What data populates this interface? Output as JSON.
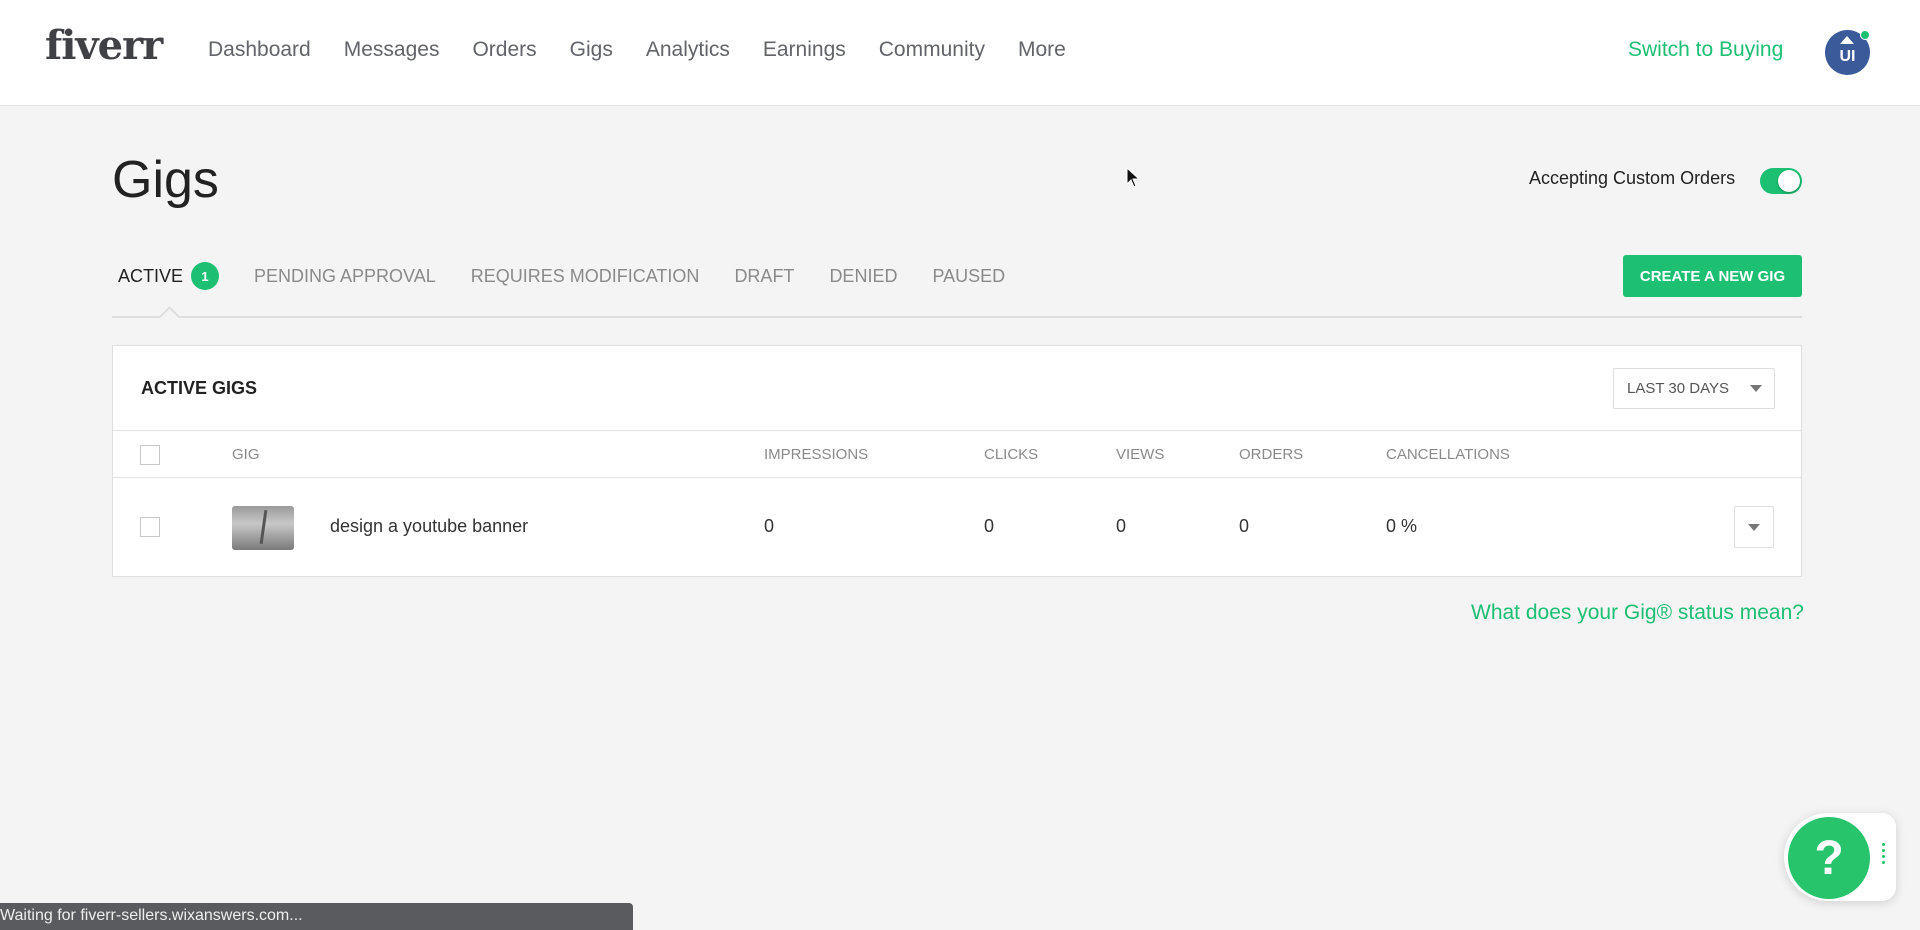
{
  "header": {
    "logo": "fiverr",
    "nav": [
      "Dashboard",
      "Messages",
      "Orders",
      "Gigs",
      "Analytics",
      "Earnings",
      "Community",
      "More"
    ],
    "switch_label": "Switch to Buying",
    "avatar_initials": "UI"
  },
  "page": {
    "title": "Gigs",
    "custom_orders_label": "Accepting Custom Orders",
    "custom_orders_enabled": true
  },
  "tabs": [
    {
      "label": "ACTIVE",
      "count": "1",
      "active": true
    },
    {
      "label": "PENDING APPROVAL"
    },
    {
      "label": "REQUIRES MODIFICATION"
    },
    {
      "label": "DRAFT"
    },
    {
      "label": "DENIED"
    },
    {
      "label": "PAUSED"
    }
  ],
  "create_button": "CREATE A NEW GIG",
  "table": {
    "title": "ACTIVE GIGS",
    "range": "LAST 30 DAYS",
    "columns": [
      "GIG",
      "IMPRESSIONS",
      "CLICKS",
      "VIEWS",
      "ORDERS",
      "CANCELLATIONS"
    ],
    "rows": [
      {
        "title": "design a youtube banner",
        "impressions": "0",
        "clicks": "0",
        "views": "0",
        "orders": "0",
        "cancellations": "0 %"
      }
    ]
  },
  "status_link": "What does your Gig® status mean?",
  "help": {
    "label": "?"
  },
  "statusbar": "Waiting for fiverr-sellers.wixanswers.com...",
  "colors": {
    "brand_green": "#1dbf73",
    "avatar_blue": "#3a5a99"
  }
}
